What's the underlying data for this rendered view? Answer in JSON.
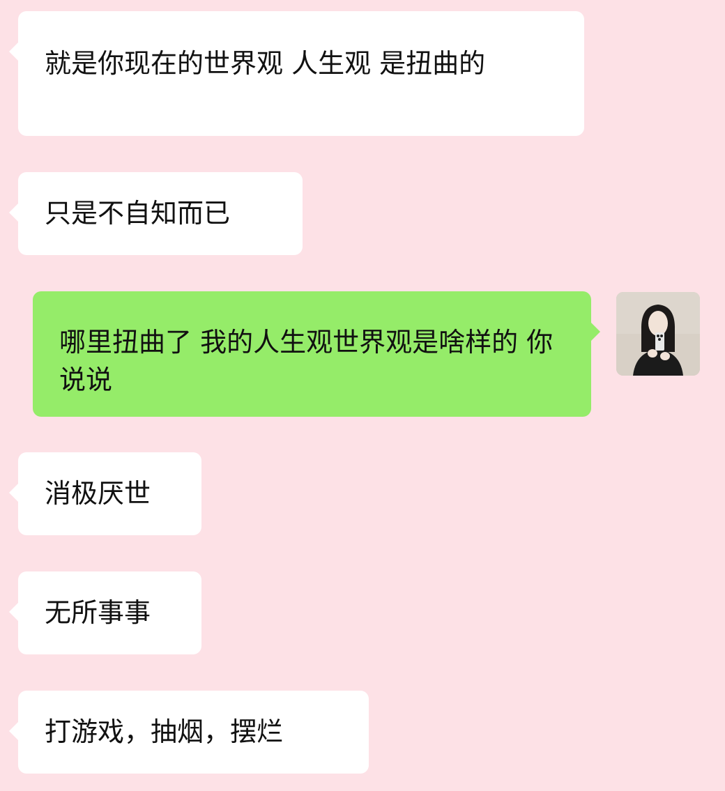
{
  "messages": [
    {
      "side": "in",
      "text": "就是你现在的世界观 人生观 是扭曲的"
    },
    {
      "side": "in",
      "text": "只是不自知而已"
    },
    {
      "side": "out",
      "text": "哪里扭曲了 我的人生观世界观是啥样的 你说说"
    },
    {
      "side": "in",
      "text": "消极厌世"
    },
    {
      "side": "in",
      "text": "无所事事"
    },
    {
      "side": "in",
      "text": "打游戏，抽烟，摆烂"
    }
  ],
  "avatar": {
    "icon": "user-photo-avatar"
  },
  "colors": {
    "background": "#fde1e6",
    "incoming_bubble": "#ffffff",
    "outgoing_bubble": "#95ec69",
    "text": "#111111"
  }
}
